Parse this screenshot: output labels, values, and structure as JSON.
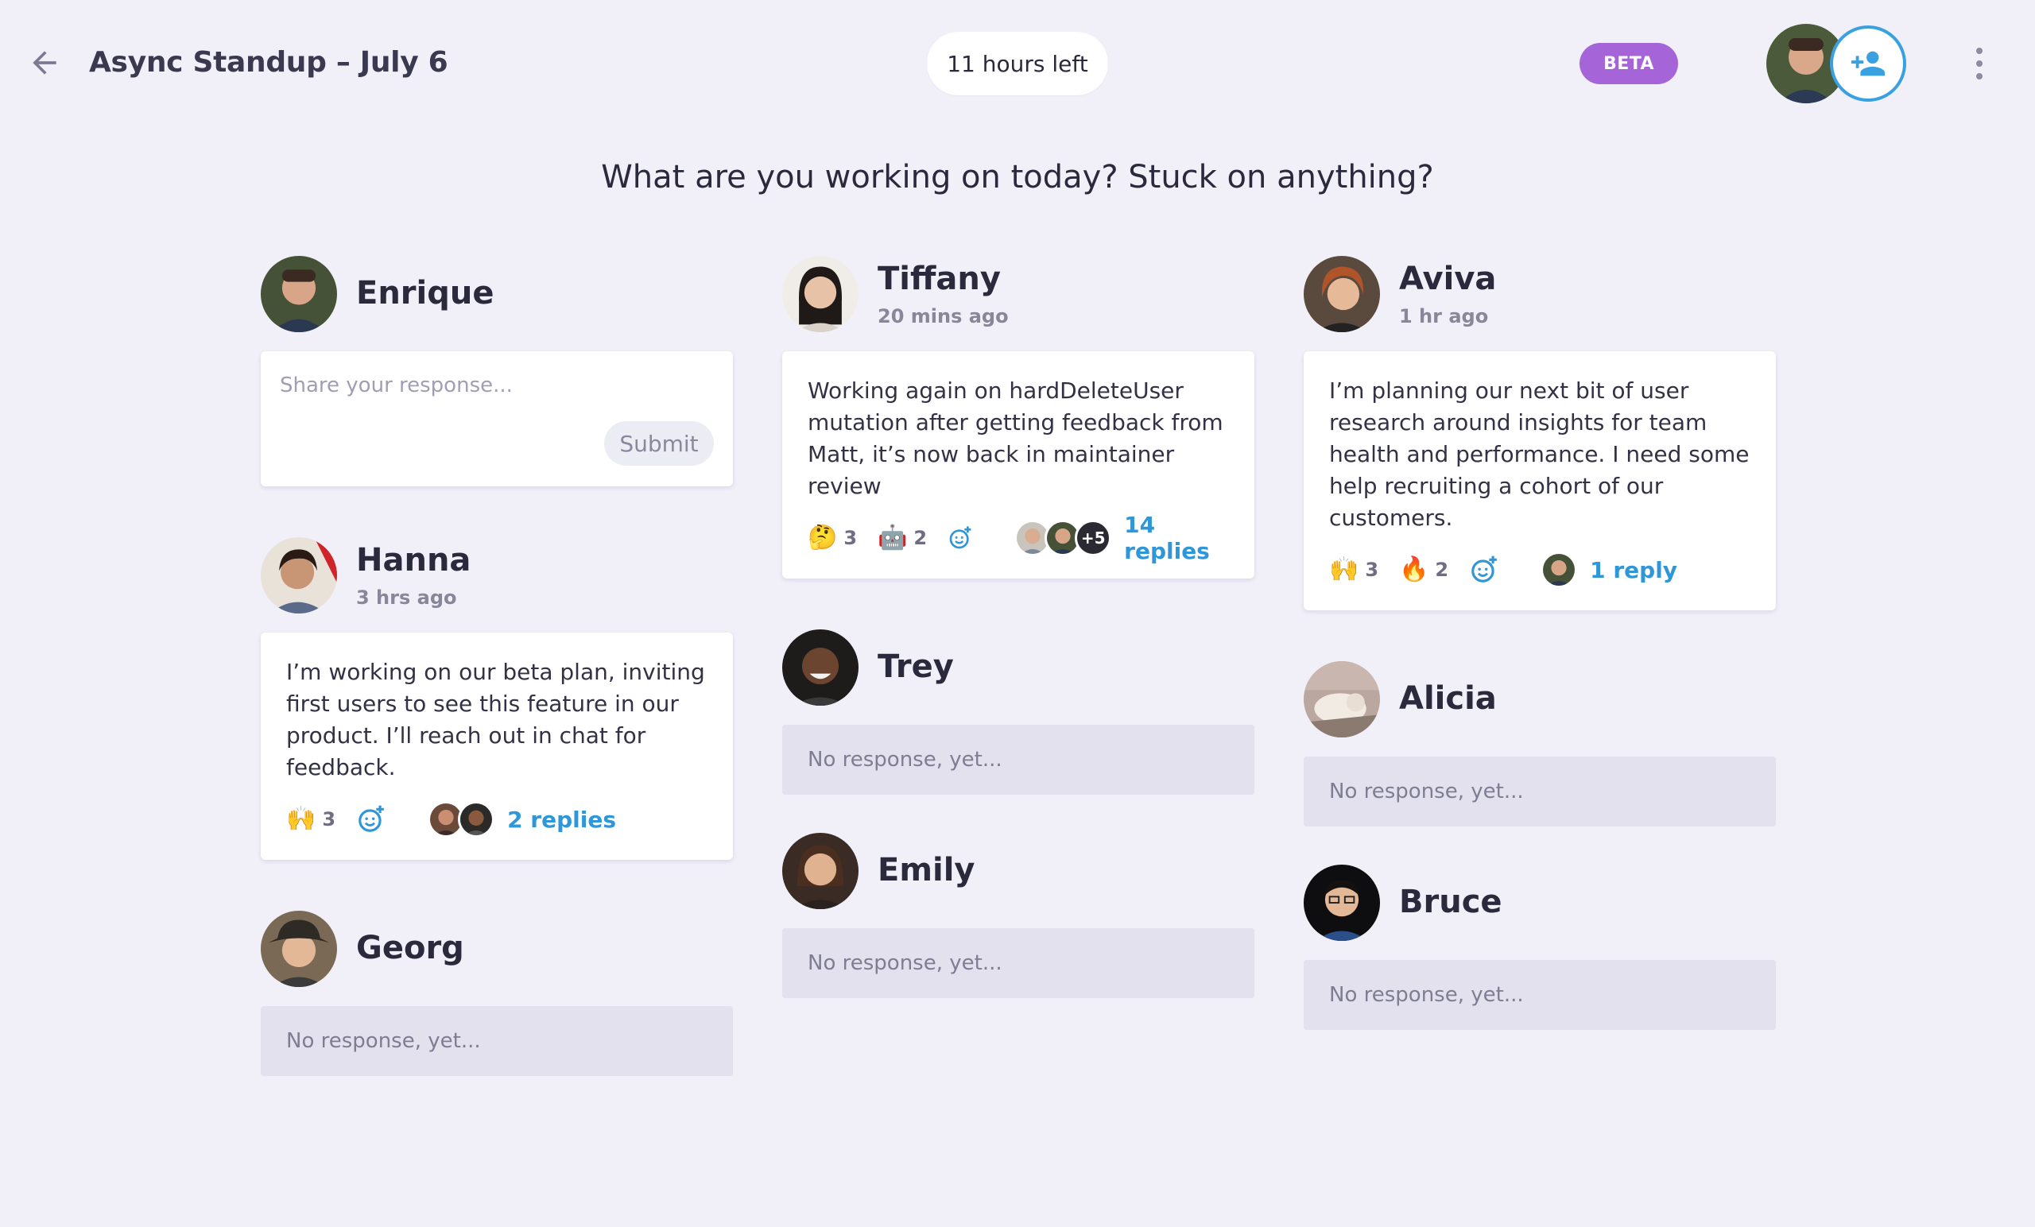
{
  "header": {
    "title": "Async Standup – July 6",
    "time_left": "11 hours left",
    "beta_label": "BETA"
  },
  "question": "What are you working on today? Stuck on anything?",
  "colors": {
    "accent": "#2f97d8",
    "beta": "#a565d9",
    "background": "#f1f0f9"
  },
  "columns": [
    {
      "people": [
        {
          "name": "Enrique",
          "input_placeholder": "Share your response...",
          "submit_label": "Submit"
        },
        {
          "name": "Hanna",
          "time": "3 hrs ago",
          "text": "I’m working on our beta plan, inviting first users to see this feature in our product. I’ll reach out in chat for feedback.",
          "reactions": [
            {
              "emoji": "🙌",
              "count": "3"
            }
          ],
          "replies": "2 replies"
        },
        {
          "name": "Georg",
          "status": "No response, yet..."
        }
      ]
    },
    {
      "people": [
        {
          "name": "Tiffany",
          "time": "20 mins ago",
          "text": "Working again on hardDeleteUser mutation after getting feedback from Matt, it’s now back in maintainer review",
          "reactions": [
            {
              "emoji": "🤔",
              "count": "3"
            },
            {
              "emoji": "🤖",
              "count": "2"
            }
          ],
          "more_count": "+5",
          "replies": "14 replies"
        },
        {
          "name": "Trey",
          "status": "No response, yet..."
        },
        {
          "name": "Emily",
          "status": "No response, yet..."
        }
      ]
    },
    {
      "people": [
        {
          "name": "Aviva",
          "time": "1 hr ago",
          "text": "I’m planning our next bit of user research around insights for team health and performance. I need some help recruiting a cohort of our customers.",
          "reactions": [
            {
              "emoji": "🙌",
              "count": "3"
            },
            {
              "emoji": "🔥",
              "count": "2"
            }
          ],
          "replies": "1 reply"
        },
        {
          "name": "Alicia",
          "status": "No response, yet..."
        },
        {
          "name": "Bruce",
          "status": "No response, yet..."
        }
      ]
    }
  ],
  "icons": [
    "back-arrow-icon",
    "add-person-icon",
    "more-vertical-icon",
    "add-reaction-icon"
  ]
}
